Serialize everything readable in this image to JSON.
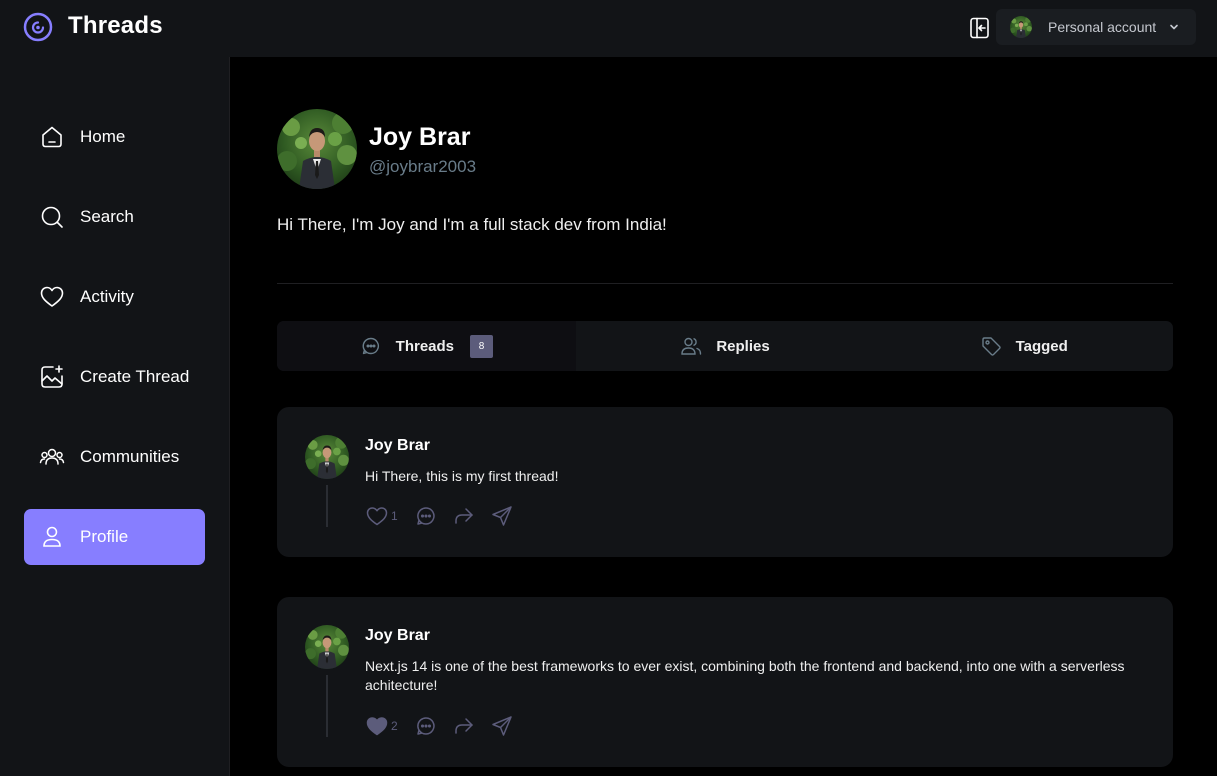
{
  "app": {
    "brand": "Threads"
  },
  "topbar": {
    "org_label": "Personal account"
  },
  "sidebar": {
    "items": [
      {
        "label": "Home",
        "icon": "home-icon"
      },
      {
        "label": "Search",
        "icon": "search-icon"
      },
      {
        "label": "Activity",
        "icon": "heart-icon"
      },
      {
        "label": "Create Thread",
        "icon": "create-image-icon"
      },
      {
        "label": "Communities",
        "icon": "community-icon"
      },
      {
        "label": "Profile",
        "icon": "user-icon",
        "active": true
      }
    ]
  },
  "profile": {
    "name": "Joy Brar",
    "handle": "@joybrar2003",
    "bio": "Hi There, I'm Joy and I'm a full stack dev from India!"
  },
  "tabs": [
    {
      "label": "Threads",
      "icon": "chat-icon",
      "count": "8",
      "active": true
    },
    {
      "label": "Replies",
      "icon": "members-icon"
    },
    {
      "label": "Tagged",
      "icon": "tag-icon"
    }
  ],
  "threads": [
    {
      "author": "Joy Brar",
      "text": "Hi There, this is my first thread!",
      "likes": "1",
      "liked": false
    },
    {
      "author": "Joy Brar",
      "text": "Next.js 14 is one of the best frameworks to ever exist, combining both the frontend and backend, into one with a serverless achitecture!",
      "likes": "2",
      "liked": true
    }
  ],
  "colors": {
    "primary": "#877eff",
    "dark_1": "#000000",
    "dark_2": "#121417",
    "gray": "#697c89",
    "muted": "#5c5c7b"
  }
}
